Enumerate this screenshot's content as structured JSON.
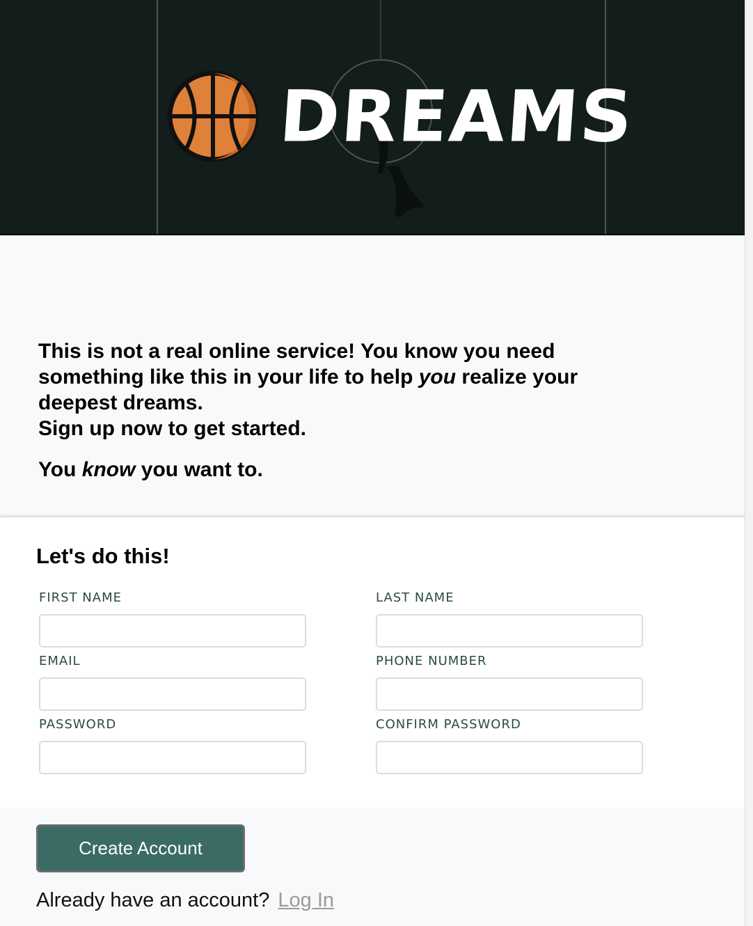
{
  "hero": {
    "brand_name": "DREAMS",
    "logo_icon": "basketball-icon",
    "colors": {
      "background": "#121d1c",
      "ball": "#e0813a",
      "ball_shade": "#c96a28"
    }
  },
  "intro": {
    "line1_part1": "This is not a real online service! You know you need something like this in your life to help ",
    "line1_emph": "you",
    "line1_part2": " realize your deepest dreams.",
    "line2": "Sign up now to get started.",
    "line3_part1": "You ",
    "line3_emph": "know",
    "line3_part2": " you want to."
  },
  "form": {
    "title": "Let's do this!",
    "fields": [
      {
        "label": "FIRST NAME",
        "value": "",
        "placeholder": ""
      },
      {
        "label": "LAST NAME",
        "value": "",
        "placeholder": ""
      },
      {
        "label": "EMAIL",
        "value": "",
        "placeholder": ""
      },
      {
        "label": "PHONE NUMBER",
        "value": "",
        "placeholder": ""
      },
      {
        "label": "PASSWORD",
        "value": "",
        "placeholder": ""
      },
      {
        "label": "CONFIRM PASSWORD",
        "value": "",
        "placeholder": ""
      }
    ]
  },
  "actions": {
    "create_label": "Create Account",
    "login_prompt": "Already have an account?",
    "login_link": "Log In",
    "colors": {
      "button": "#3a6b65",
      "label_text": "#2b4a48"
    }
  }
}
